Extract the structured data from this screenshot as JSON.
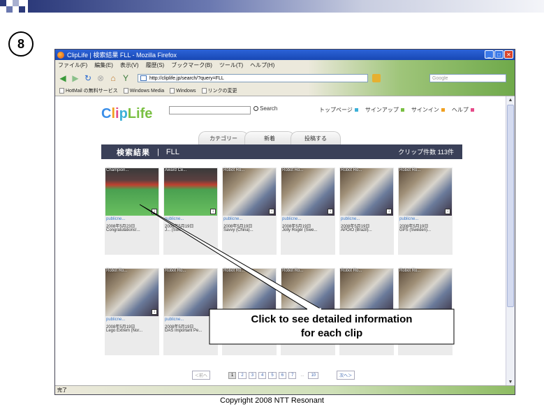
{
  "slide": {
    "step_number": "8",
    "callout": [
      "Click to see detailed information",
      "for each clip"
    ],
    "copyright": "Copyright 2008 NTT Resonant"
  },
  "browser": {
    "title": "ClipLife | 検索結果 FLL - Mozilla Firefox",
    "menu": [
      "ファイル(F)",
      "編集(E)",
      "表示(V)",
      "履歴(S)",
      "ブックマーク(B)",
      "ツール(T)",
      "ヘルプ(H)"
    ],
    "url": "http://cliplife.jp/search/?query=FLL",
    "search_engine_placeholder": "Google",
    "bookmarks": [
      "HotMail の無料サービス",
      "Windows Media",
      "Windows",
      "リンクの変更"
    ],
    "status": "完了"
  },
  "site": {
    "logo": {
      "c": "C",
      "l": "l",
      "i": "i",
      "p": "p",
      "life": "Life"
    },
    "search_label": "Search",
    "top_links": [
      {
        "label": "トップページ",
        "color": "#3cb0d8"
      },
      {
        "label": "サインアップ",
        "color": "#7ac043"
      },
      {
        "label": "サインイン",
        "color": "#f0a020"
      },
      {
        "label": "ヘルプ",
        "color": "#e64c8a"
      }
    ],
    "tabs": [
      "カテゴリー",
      "新着",
      "投稿する"
    ],
    "results_title": "検索結果",
    "results_sep": "|",
    "results_query": "FLL",
    "results_count": "クリップ件数 113件",
    "clips": [
      {
        "caption": "Champion...",
        "user": "publicne...",
        "date": "2008年5月23日",
        "title": "Congratulations!...",
        "scene": "field"
      },
      {
        "caption": "Award Ce...",
        "user": "publicne...",
        "date": "2008年5月19日",
        "title": "J... (Swe...",
        "scene": "field"
      },
      {
        "caption": "Robot Ro...",
        "user": "publicne...",
        "date": "2008年5月19日",
        "title": "Savvy (China)...",
        "scene": "table"
      },
      {
        "caption": "Robot Ro...",
        "user": "publicne...",
        "date": "2008年5月19日",
        "title": "Jolly Roger (Swe...",
        "scene": "table"
      },
      {
        "caption": "Robot Ro...",
        "user": "publicne...",
        "date": "2008年5月19日",
        "title": "APOIO (Brazil)...",
        "scene": "table"
      },
      {
        "caption": "Robot Ro...",
        "user": "publicne...",
        "date": "2008年5月19日",
        "title": "GPS (Sweden)...",
        "scene": "table"
      },
      {
        "caption": "Robot Ro...",
        "user": "publicne...",
        "date": "2008年5月19日",
        "title": "Lego Extrem (Nor...",
        "scene": "table"
      },
      {
        "caption": "Robot Ro...",
        "user": "publicne...",
        "date": "2008年5月19日",
        "title": "DAS Important Pe...",
        "scene": "table"
      },
      {
        "caption": "Robot Ro...",
        "user": "",
        "date": "",
        "title": "",
        "scene": "table"
      },
      {
        "caption": "Robot Ro...",
        "user": "",
        "date": "",
        "title": "",
        "scene": "table"
      },
      {
        "caption": "Robot Ro...",
        "user": "",
        "date": "",
        "title": "",
        "scene": "table"
      },
      {
        "caption": "Robot Ro...",
        "user": "",
        "date": "",
        "title": "",
        "scene": "table"
      }
    ],
    "pager": {
      "prev": "＜前へ",
      "pages": [
        "1",
        "2",
        "3",
        "4",
        "5",
        "6",
        "7"
      ],
      "ellipsis": "...",
      "last": "10",
      "next": "次へ＞",
      "current": "1"
    }
  }
}
